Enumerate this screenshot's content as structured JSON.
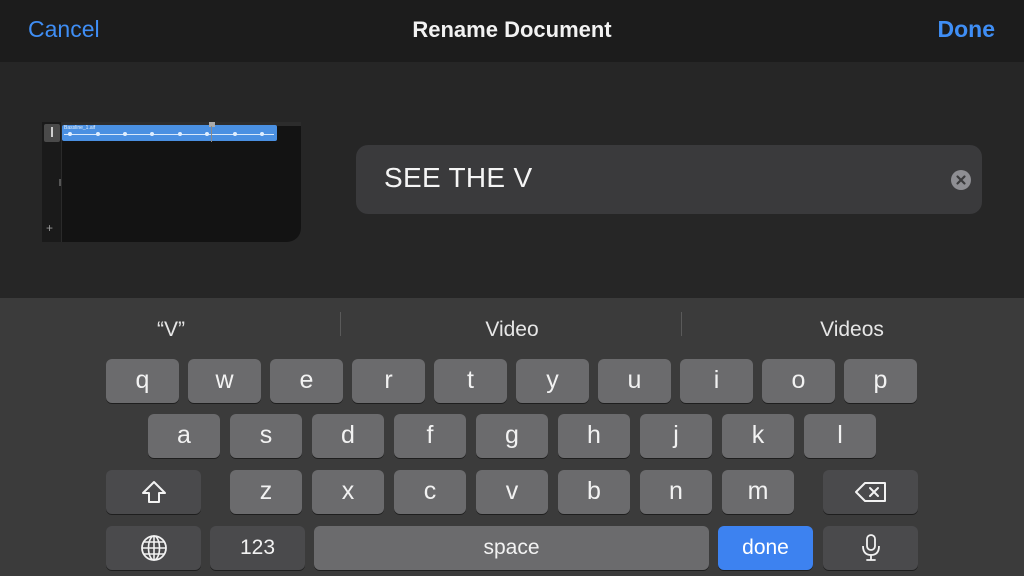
{
  "nav": {
    "cancel_label": "Cancel",
    "title": "Rename Document",
    "done_label": "Done"
  },
  "document": {
    "name_value": "SEE THE V",
    "thumbnail": {
      "region_label": "Bassline_1.aif",
      "track_icon": "track-icon",
      "add_icon": "plus-icon"
    }
  },
  "keyboard": {
    "suggestions": [
      "“V”",
      "Video",
      "Videos"
    ],
    "rows": [
      [
        "q",
        "w",
        "e",
        "r",
        "t",
        "y",
        "u",
        "i",
        "o",
        "p"
      ],
      [
        "a",
        "s",
        "d",
        "f",
        "g",
        "h",
        "j",
        "k",
        "l"
      ],
      [
        "z",
        "x",
        "c",
        "v",
        "b",
        "n",
        "m"
      ]
    ],
    "shift_icon": "shift-icon",
    "delete_icon": "delete-icon",
    "globe_icon": "globe-icon",
    "numbers_label": "123",
    "space_label": "space",
    "done_label": "done",
    "mic_icon": "microphone-icon"
  },
  "colors": {
    "accent": "#3f8ef5",
    "done_key": "#3d82f0",
    "key": "#6b6b6d",
    "key_dark": "#4a4a4c",
    "keyboard_bg": "#3b3b3b",
    "field_bg": "#3a3a3c"
  }
}
